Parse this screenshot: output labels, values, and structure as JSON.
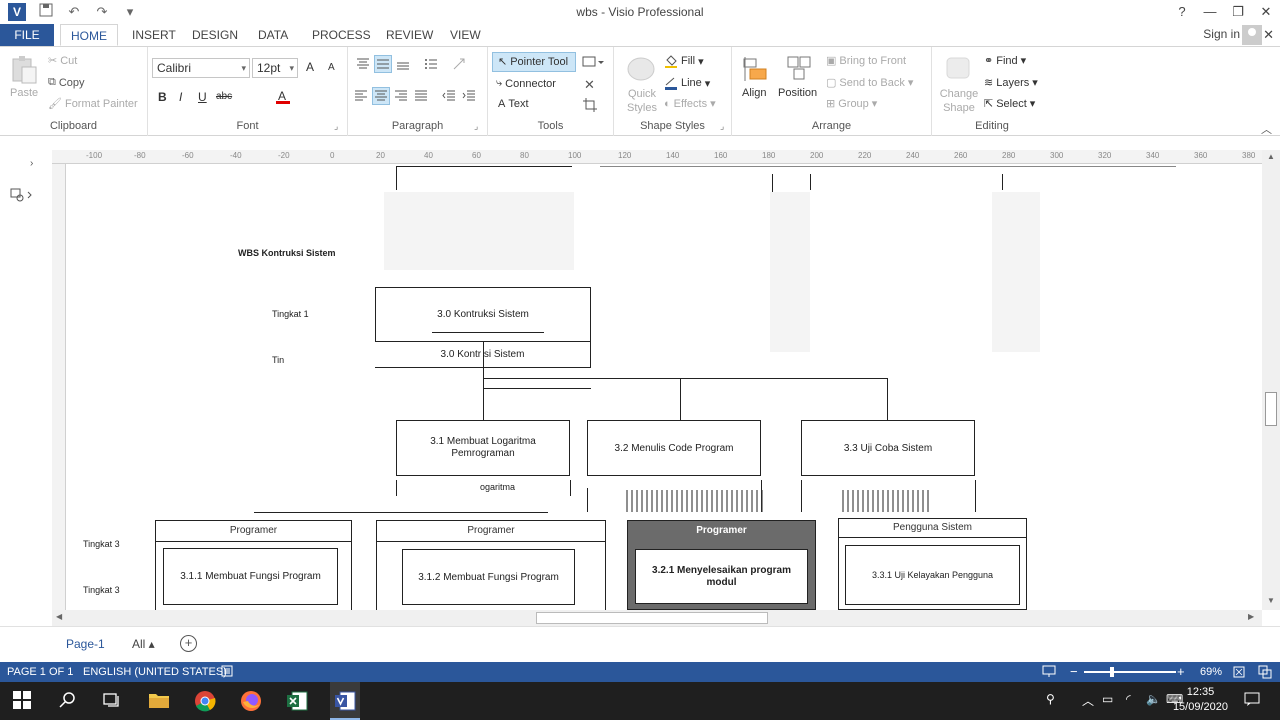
{
  "window": {
    "title": "wbs - Visio Professional",
    "help": "?",
    "minimize": "—",
    "restore": "❐",
    "close": "✕",
    "sign_in": "Sign in",
    "close_doc": "✕"
  },
  "tabs": [
    "FILE",
    "HOME",
    "INSERT",
    "DESIGN",
    "DATA",
    "PROCESS",
    "REVIEW",
    "VIEW"
  ],
  "active_tab": "HOME",
  "ribbon": {
    "clipboard": {
      "label": "Clipboard",
      "paste": "Paste",
      "cut": "Cut",
      "copy": "Copy",
      "format_painter": "Format Painter"
    },
    "font": {
      "label": "Font",
      "family": "Calibri",
      "size": "12pt",
      "bold": "B",
      "italic": "I",
      "underline": "U",
      "strike": "abc",
      "grow": "A",
      "shrink": "A"
    },
    "paragraph": {
      "label": "Paragraph"
    },
    "tools": {
      "label": "Tools",
      "pointer": "Pointer Tool",
      "connector": "Connector",
      "text": "Text"
    },
    "shape_styles": {
      "label": "Shape Styles",
      "quick_styles": "Quick Styles",
      "fill": "Fill",
      "line": "Line",
      "effects": "Effects"
    },
    "arrange": {
      "label": "Arrange",
      "align": "Align",
      "position": "Position",
      "bring_front": "Bring to Front",
      "send_back": "Send to Back",
      "group": "Group"
    },
    "editing": {
      "label": "Editing",
      "change_shape": "Change Shape",
      "find": "Find",
      "layers": "Layers",
      "select": "Select"
    }
  },
  "ruler_ticks": [
    "-100",
    "-80",
    "-60",
    "-40",
    "-20",
    "0",
    "20",
    "40",
    "60",
    "80",
    "100",
    "120",
    "140",
    "160",
    "180",
    "200",
    "220",
    "240",
    "260",
    "280",
    "300",
    "320",
    "340",
    "360",
    "380"
  ],
  "diagram": {
    "title": "WBS Kontruksi Sistem",
    "level1": "Tingkat 1",
    "level1_ghost": "Tin",
    "level3a": "Tingkat 3",
    "level3b": "Tingkat 3",
    "root": "3.0 Kontruksi Sistem",
    "root_ghost": "3.0 Kontr  si Sistem",
    "node_31": "3.1 Membuat Logaritma Pemrograman",
    "node_31_ghost": "ogaritma",
    "node_32": "3.2 Menulis Code Program",
    "node_33": "3.3 Uji Coba Sistem",
    "head_programer_1": "Programer",
    "head_programer_2": "Programer",
    "head_programer_3": "Programer",
    "head_pengguna": "Pengguna Sistem",
    "leaf_311": "3.1.1 Membuat Fungsi Program",
    "leaf_312": "3.1.2 Membuat Fungsi Program",
    "leaf_321": "3.2.1 Menyelesaikan program modul",
    "leaf_331": "3.3.1 Uji Kelayakan Pengguna"
  },
  "page_tabs": {
    "page": "Page-1",
    "all": "All ▴",
    "add": "+"
  },
  "status": {
    "page": "PAGE 1 OF 1",
    "language": "ENGLISH (UNITED STATES)",
    "zoom": "69%",
    "zoom_minus": "−",
    "zoom_plus": "+"
  },
  "taskbar": {
    "time": "12:35",
    "date": "15/09/2020"
  }
}
